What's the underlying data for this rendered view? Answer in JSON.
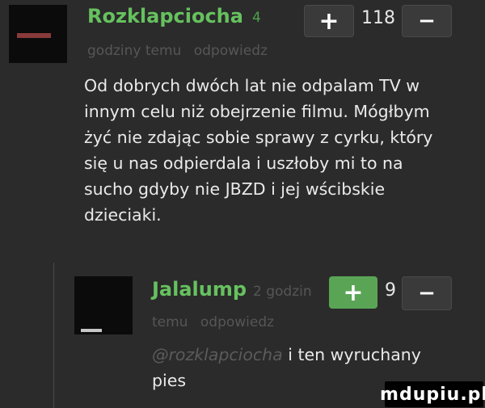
{
  "comment1": {
    "author": "Rozklapciocha",
    "points": "4",
    "meta": "godziny temu",
    "reply": "odpowiedz",
    "score": "118",
    "plus": "+",
    "minus": "−",
    "text": "Od dobrych dwóch lat nie odpalam TV w innym celu niż obejrzenie filmu. Mógłbym żyć nie zdając sobie sprawy z cyrku, który się u nas odpierdala i uszłoby mi to na sucho gdyby nie JBZD i jej wścibskie dzieciaki."
  },
  "comment2": {
    "author": "Jalalump",
    "meta_first": "2 godzin",
    "meta_second": "temu",
    "reply": "odpowiedz",
    "score": "9",
    "plus": "+",
    "minus": "−",
    "mention": "@rozklapciocha",
    "text_after": " i ten wyruchany",
    "text_line2": "pies"
  },
  "watermark": "mdupiu.pl",
  "colors": {
    "background": "#2b2b2b",
    "username": "#66c15f",
    "upvote_active": "#5aa555"
  }
}
